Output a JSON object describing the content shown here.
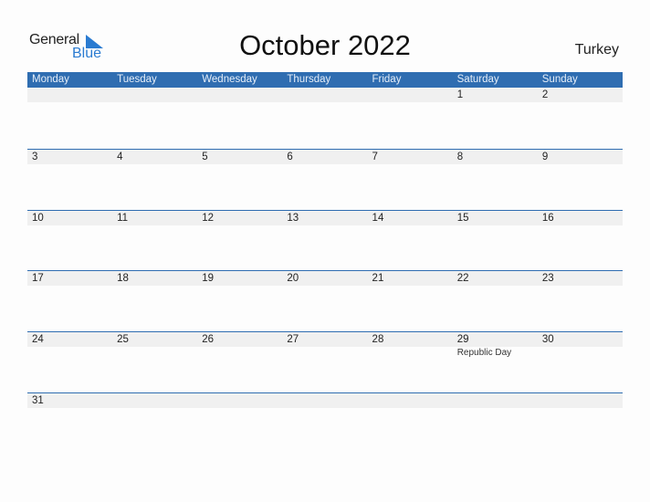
{
  "logo": {
    "line1": "General",
    "line2": "Blue"
  },
  "title": "October 2022",
  "country": "Turkey",
  "weekdays": [
    "Monday",
    "Tuesday",
    "Wednesday",
    "Thursday",
    "Friday",
    "Saturday",
    "Sunday"
  ],
  "weeks": [
    [
      "",
      "",
      "",
      "",
      "",
      "1",
      "2"
    ],
    [
      "3",
      "4",
      "5",
      "6",
      "7",
      "8",
      "9"
    ],
    [
      "10",
      "11",
      "12",
      "13",
      "14",
      "15",
      "16"
    ],
    [
      "17",
      "18",
      "19",
      "20",
      "21",
      "22",
      "23"
    ],
    [
      "24",
      "25",
      "26",
      "27",
      "28",
      "29",
      "30"
    ],
    [
      "31",
      "",
      "",
      "",
      "",
      "",
      ""
    ]
  ],
  "holidays": {
    "29": "Republic Day"
  },
  "colors": {
    "accent": "#2f6db1",
    "logo_blue": "#2a7bd1",
    "band": "#f0f0f0"
  }
}
